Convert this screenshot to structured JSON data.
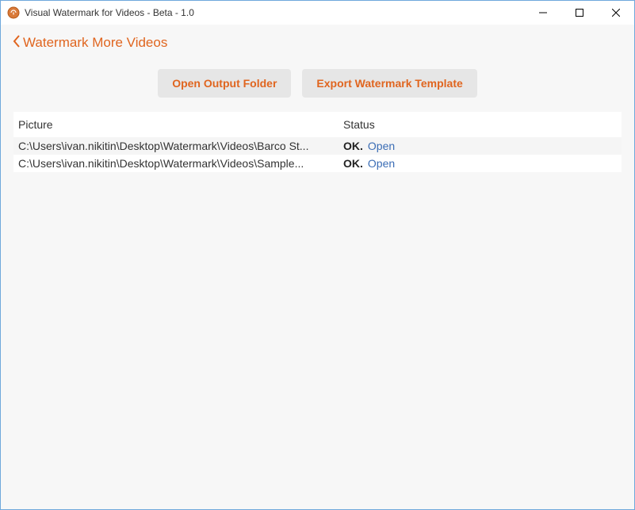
{
  "window": {
    "title": "Visual Watermark for Videos - Beta - 1.0"
  },
  "nav": {
    "back_label": "Watermark More Videos"
  },
  "buttons": {
    "open_output": "Open Output Folder",
    "export_template": "Export Watermark Template"
  },
  "table": {
    "headers": {
      "picture": "Picture",
      "status": "Status"
    },
    "rows": [
      {
        "picture": "C:\\Users\\ivan.nikitin\\Desktop\\Watermark\\Videos\\Barco St...",
        "status": "OK.",
        "link": "Open"
      },
      {
        "picture": "C:\\Users\\ivan.nikitin\\Desktop\\Watermark\\Videos\\Sample...",
        "status": "OK.",
        "link": "Open"
      }
    ]
  }
}
